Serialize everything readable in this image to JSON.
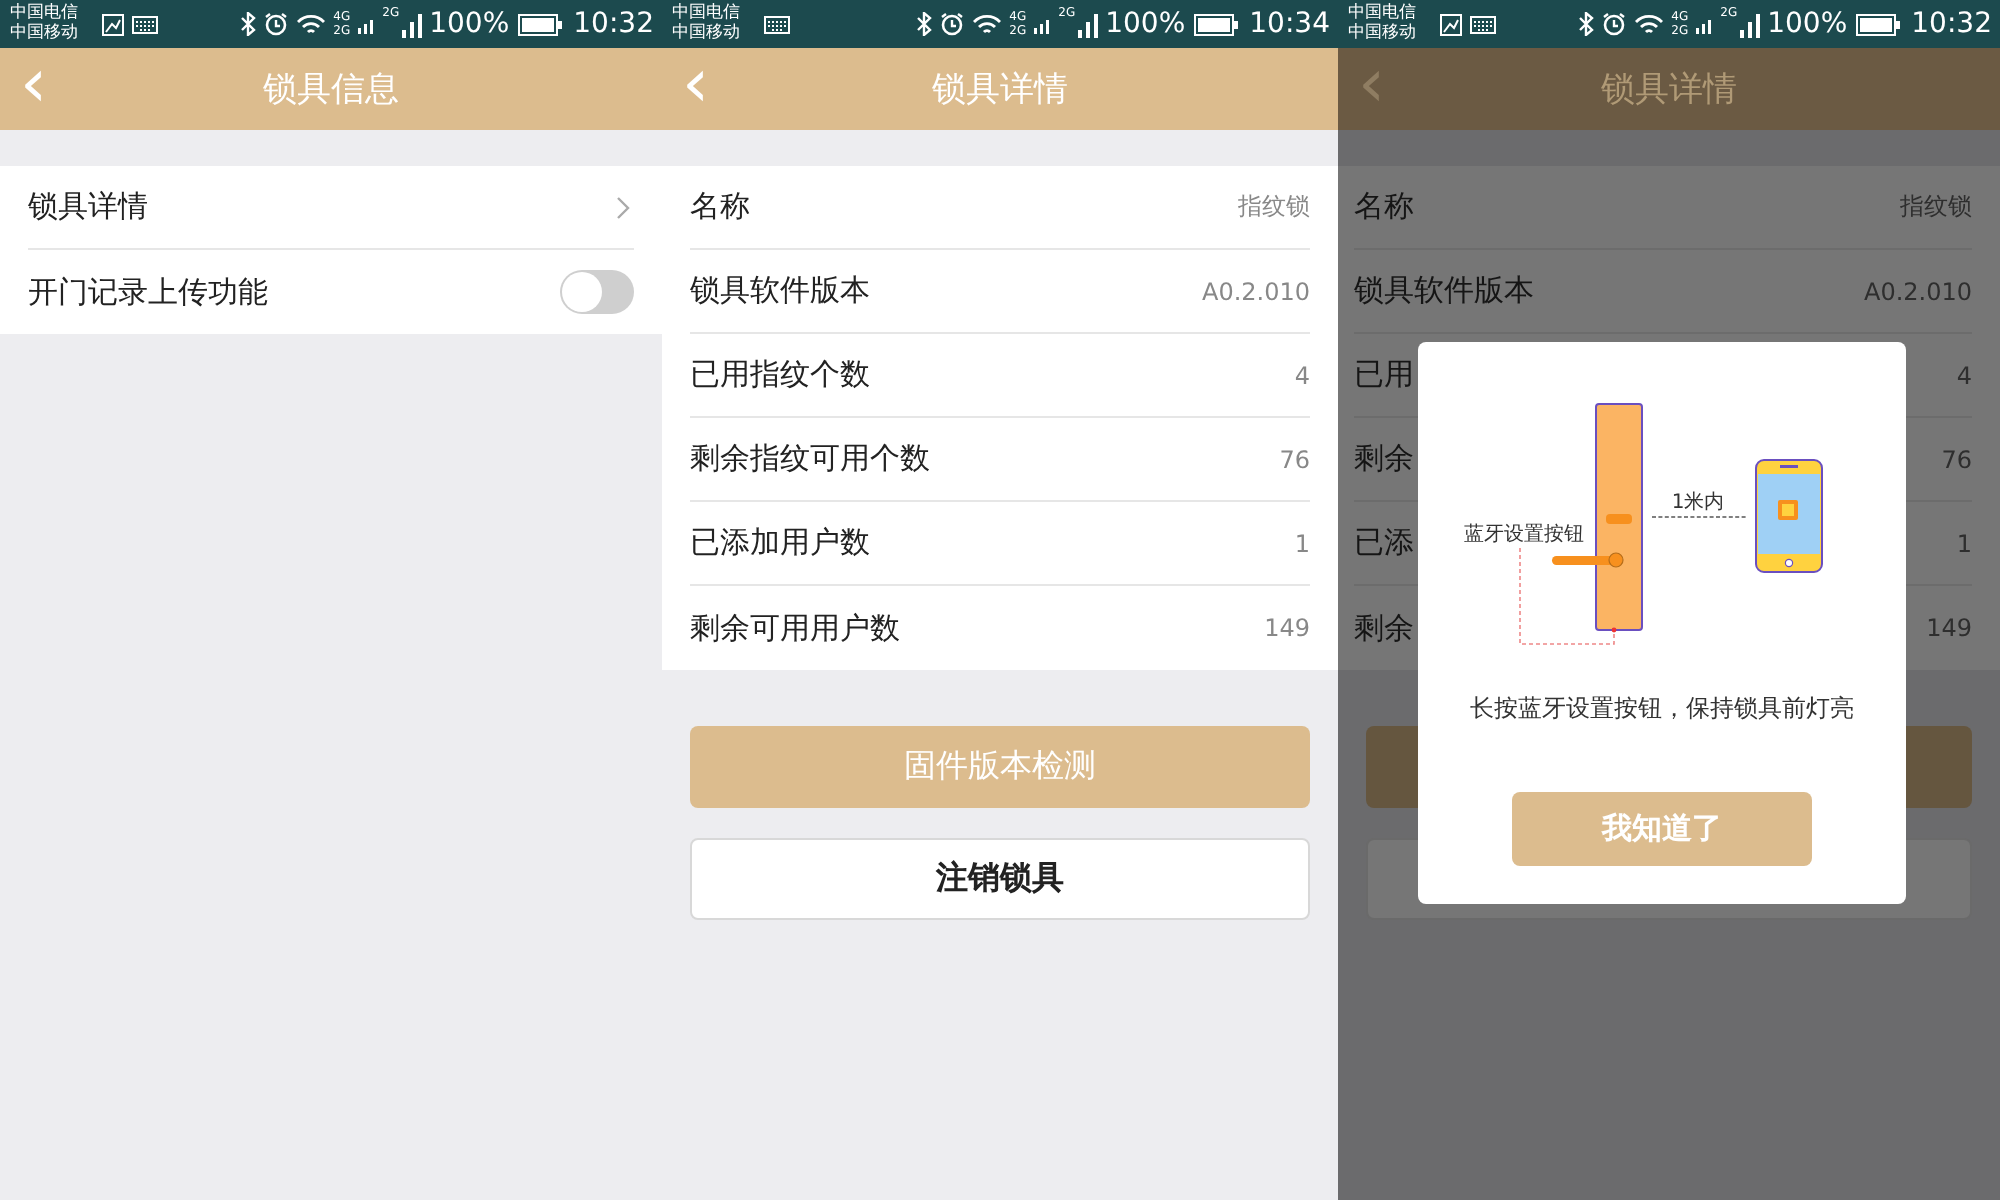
{
  "screens": [
    {
      "status_bar": {
        "carriers": [
          "中国电信",
          "中国移动"
        ],
        "notification_icons": [
          {
            "kind": "image"
          },
          {
            "kind": "keyboard"
          }
        ],
        "network_labels": [
          "4G",
          "2G"
        ],
        "signal_label": "2G",
        "battery": "100%",
        "time": "10:32"
      },
      "header": {
        "back": "‹",
        "title": "锁具信息"
      },
      "overlay": false,
      "rows": [
        {
          "kind": "link",
          "label": "锁具详情"
        },
        {
          "kind": "toggle",
          "label": "开门记录上传功能",
          "on": false
        }
      ]
    },
    {
      "status_bar": {
        "carriers": [
          "中国电信",
          "中国移动"
        ],
        "notification_icons": [
          {
            "kind": "keyboard"
          }
        ],
        "network_labels": [
          "4G",
          "2G"
        ],
        "signal_label": "2G",
        "battery": "100%",
        "time": "10:34"
      },
      "header": {
        "back": "‹",
        "title": "锁具详情"
      },
      "overlay": false,
      "rows": [
        {
          "kind": "value",
          "label": "名称",
          "value": "指纹锁"
        },
        {
          "kind": "value",
          "label": "锁具软件版本",
          "value": "A0.2.010"
        },
        {
          "kind": "value",
          "label": "已用指纹个数",
          "value": "4"
        },
        {
          "kind": "value",
          "label": "剩余指纹可用个数",
          "value": "76"
        },
        {
          "kind": "value",
          "label": "已添加用户数",
          "value": "1"
        },
        {
          "kind": "value",
          "label": "剩余可用用户数",
          "value": "149"
        }
      ],
      "buttons": [
        {
          "kind": "primary",
          "label": "固件版本检测"
        },
        {
          "kind": "secondary",
          "label": "注销锁具"
        }
      ]
    },
    {
      "status_bar": {
        "carriers": [
          "中国电信",
          "中国移动"
        ],
        "notification_icons": [
          {
            "kind": "image"
          },
          {
            "kind": "keyboard"
          }
        ],
        "network_labels": [
          "4G",
          "2G"
        ],
        "signal_label": "2G",
        "battery": "100%",
        "time": "10:32"
      },
      "header": {
        "back": "‹",
        "title": "锁具详情"
      },
      "overlay": true,
      "rows": [
        {
          "kind": "value",
          "label": "名称",
          "value": "指纹锁"
        },
        {
          "kind": "value",
          "label": "锁具软件版本",
          "value": "A0.2.010"
        },
        {
          "kind": "value",
          "label": "已用",
          "value": "4"
        },
        {
          "kind": "value",
          "label": "剩余",
          "value": "76"
        },
        {
          "kind": "value",
          "label": "已添",
          "value": "1"
        },
        {
          "kind": "value",
          "label": "剩余",
          "value": "149"
        }
      ],
      "buttons": [
        {
          "kind": "primary"
        },
        {
          "kind": "secondary"
        }
      ],
      "dialog": {
        "button_label": "蓝牙设置按钮",
        "distance_label": "1米内",
        "message": "长按蓝牙设置按钮，保持锁具前灯亮",
        "button": "我知道了"
      }
    }
  ]
}
